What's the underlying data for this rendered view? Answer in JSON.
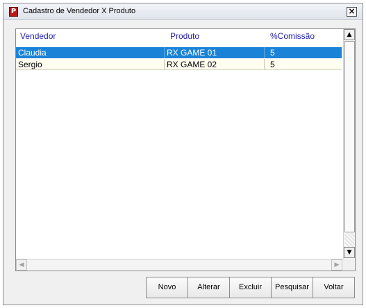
{
  "window": {
    "title": "Cadastro de Vendedor X Produto",
    "app_icon_glyph": "P",
    "close_glyph": "×"
  },
  "grid": {
    "columns": [
      "Vendedor",
      "Produto",
      "%Comissão"
    ],
    "rows": [
      {
        "vendedor": "Claudia",
        "produto": "RX GAME 01",
        "comissao": "5",
        "selected": true
      },
      {
        "vendedor": "Sergio",
        "produto": "RX GAME 02",
        "comissao": "5",
        "selected": false
      }
    ],
    "selection_color": "#1b83d7",
    "header_text_color": "#1f1fa8"
  },
  "scrollbars": {
    "up_glyph": "▲",
    "down_glyph": "▼",
    "left_glyph": "◀",
    "right_glyph": "▶"
  },
  "buttons": {
    "novo": "Novo",
    "alterar": "Alterar",
    "excluir": "Excluir",
    "pesquisar": "Pesquisar",
    "voltar": "Voltar"
  }
}
